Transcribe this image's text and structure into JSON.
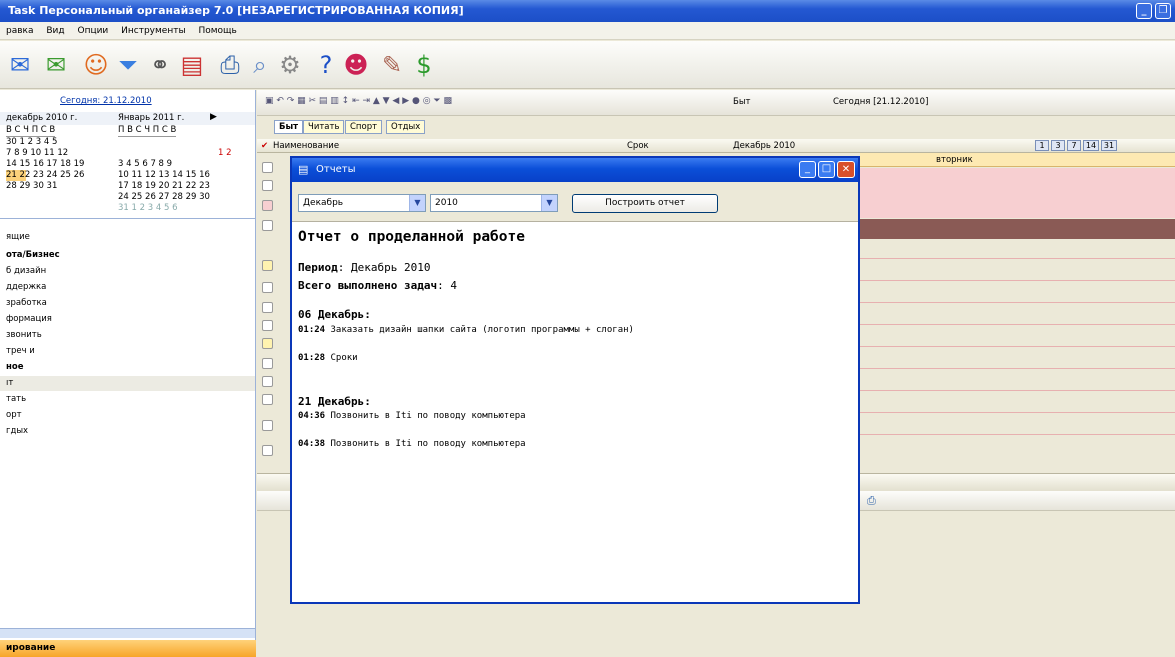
{
  "window": {
    "title": "Task Персональный органайзер 7.0 [НЕЗАРЕГИСТРИРОВАННАЯ КОПИЯ]"
  },
  "menu": [
    "равка",
    "Вид",
    "Опции",
    "Инструменты",
    "Помощь"
  ],
  "calendar": {
    "today_link": "Сегодня: 21.12.2010",
    "month1": "декабрь 2010 г.",
    "month2": "Январь 2011 г.",
    "weekdays1": "В С Ч П С В",
    "weekdays2": "П В С Ч П С В",
    "m1_rows": [
      "30 1 2 3 4 5",
      "7 8 9 10 11 12",
      "14 15 16 17 18 19",
      "21 22 23 24 25 26",
      "28 29 30 31"
    ],
    "m2_rows": [
      "1 2",
      "3 4 5 6 7 8 9",
      "10 11 12 13 14 15 16",
      "17 18 19 20 21 22 23",
      "24 25 26 27 28 29 30",
      "31 1 2 3 4 5 6"
    ]
  },
  "nav": [
    "ящие",
    "ота/Бизнес",
    "б дизайн",
    "ддержка",
    "зработка",
    "формация",
    "звонить",
    "треч и",
    "ное",
    "ıт",
    "тать",
    "орт",
    "гдых"
  ],
  "bottom_label": "ирование",
  "tabs": [
    "Быт",
    "Читать",
    "Спорт",
    "Отдых"
  ],
  "grid": {
    "col_name": "Наименование",
    "col_deadline": "Срок",
    "month_label": "Декабрь 2010",
    "day_header": "вторник",
    "view_buttons": [
      "1",
      "3",
      "7",
      "14",
      "31"
    ]
  },
  "toolbar2": {
    "byt": "Быт",
    "today": "Сегодня [21.12.2010]"
  },
  "dialog": {
    "title": "Отчеты",
    "month_value": "Декабрь",
    "year_value": "2010",
    "build_button": "Построить отчет",
    "report_title": "Отчет о проделанной работе",
    "period_label": "Период",
    "period_value": ": Декабрь 2010",
    "total_label": "Всего выполнено задач",
    "total_value": ": 4",
    "day1": "06 Декабрь",
    "day1_items": [
      {
        "time": "01:24",
        "text": " Заказать дизайн шапки сайта (логотип программы + слоган)"
      },
      {
        "time": "01:28",
        "text": " Сроки"
      }
    ],
    "day2": "21 Декабрь",
    "day2_items": [
      {
        "time": "04:36",
        "text": " Позвонить в Iti по поводу компьютера"
      },
      {
        "time": "04:38",
        "text": " Позвонить в Iti по поводу компьютера"
      }
    ]
  },
  "colors": {
    "titlebar": "#2458d2",
    "dialog_border": "#0a37b8",
    "accent_orange": "#f7a529",
    "pink_row": "#f7cfd1"
  }
}
